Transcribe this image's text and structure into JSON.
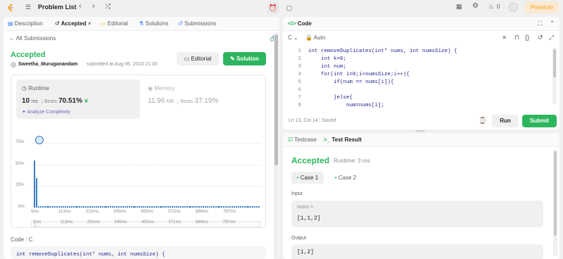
{
  "topbar": {
    "problem_list": "Problem List",
    "streak_count": "0",
    "premium": "Premium"
  },
  "left": {
    "tabs": [
      {
        "label": "Description"
      },
      {
        "label": "Accepted"
      },
      {
        "label": "Editorial"
      },
      {
        "label": "Solutions"
      },
      {
        "label": "Submissions"
      }
    ],
    "back_label": "All Submissions",
    "status": "Accepted",
    "username": "Sweetha_Muruganandam",
    "submitted_text": "submitted at Aug 06, 2024 21:00",
    "editorial_btn": "Editorial",
    "solution_btn": "Solution",
    "runtime": {
      "label": "Runtime",
      "value": "10",
      "unit": "ms",
      "beats_label": "Beats",
      "beats_value": "70.51%",
      "analyze": "Analyze Complexity"
    },
    "memory": {
      "label": "Memory",
      "value": "11.96",
      "unit": "MB",
      "beats_label": "Beats",
      "beats_value": "37.19%"
    },
    "chart_data": {
      "type": "bar",
      "yticks": [
        "75%",
        "50%",
        "25%",
        "0%"
      ],
      "ylim": [
        0,
        75
      ],
      "xticks": [
        "5ms",
        "113ms",
        "231ms",
        "345ms",
        "455ms",
        "571ms",
        "684ms",
        "797ms"
      ],
      "values": [
        55,
        35,
        2,
        2,
        2,
        2,
        2,
        2,
        2,
        2,
        2,
        2,
        2,
        2,
        2,
        2,
        2,
        2,
        2,
        2,
        2,
        2,
        2,
        2,
        2,
        2,
        2,
        2,
        2,
        2,
        2,
        2,
        2,
        2,
        2,
        2,
        2,
        2,
        2,
        2,
        2,
        2,
        2,
        2,
        2,
        2,
        2,
        2,
        2,
        2,
        2,
        2,
        2,
        2,
        2,
        2,
        2,
        2,
        2,
        2,
        2,
        2,
        2,
        2,
        2,
        2,
        2,
        2,
        2,
        2,
        2,
        2,
        2,
        2,
        2,
        2,
        2,
        2,
        2,
        2,
        2,
        2,
        2,
        2,
        2,
        2,
        2,
        2,
        2,
        2,
        2,
        2,
        2,
        2,
        2,
        2,
        2,
        2,
        2,
        2,
        2,
        2,
        2,
        2,
        2,
        2,
        2,
        2,
        2,
        2
      ]
    },
    "code_label": "Code",
    "code_lang": "C",
    "code_preview": "int removeDuplicates(int* nums, int numsSize) {"
  },
  "editor": {
    "title": "Code",
    "lang": "C",
    "auto": "Auto",
    "lines": [
      {
        "n": "1",
        "text": "int removeDuplicates(int* nums, int numsSize) {"
      },
      {
        "n": "2",
        "text": "    int k=0;"
      },
      {
        "n": "3",
        "text": "    int num;"
      },
      {
        "n": "4",
        "text": "    for(int i=0;i<numsSize;i++){"
      },
      {
        "n": "5",
        "text": "        if(num == nums[i]){"
      },
      {
        "n": "6",
        "text": ""
      },
      {
        "n": "7",
        "text": "        }else{"
      },
      {
        "n": "8",
        "text": "            num=nums[i];"
      }
    ],
    "cursor": "Ln 13, Col 14",
    "saved": "Saved",
    "run": "Run",
    "submit": "Submit"
  },
  "result": {
    "tab_testcase": "Testcase",
    "tab_result": "Test Result",
    "status": "Accepted",
    "runtime": "Runtime: 3 ms",
    "case1": "Case 1",
    "case2": "Case 2",
    "input_label": "Input",
    "input_name": "nums =",
    "input_value": "[1,1,2]",
    "output_label": "Output",
    "output_value": "[1,2]"
  },
  "colors": {
    "accent": "#2db55d",
    "orange": "#ffa116",
    "bar": "#3a7fbf"
  }
}
